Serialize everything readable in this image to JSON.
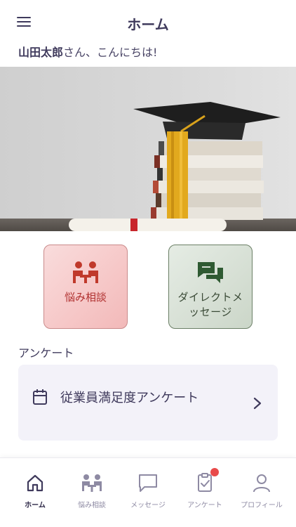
{
  "header": {
    "title": "ホーム",
    "menu_icon": "hamburger-menu-icon"
  },
  "greeting": {
    "name": "山田太郎",
    "suffix": "さん、こんにちは!"
  },
  "hero": {
    "image": "graduation-cap-on-books-photo"
  },
  "actions": [
    {
      "label": "悩み相談",
      "icon": "consultation-icon",
      "color": "#b0302f"
    },
    {
      "label_line1": "ダイレクトメ",
      "label_line2": "ッセージ",
      "icon": "chat-bubbles-icon",
      "color": "#3a4a36"
    }
  ],
  "survey_section": {
    "label": "アンケート",
    "card": {
      "text": "従業員満足度アンケート",
      "icon": "calendar-icon",
      "chevron_icon": "chevron-right-icon"
    }
  },
  "tabbar": {
    "tabs": [
      {
        "label": "ホーム",
        "icon": "home-icon",
        "active": true
      },
      {
        "label": "悩み相談",
        "icon": "consultation-icon",
        "active": false
      },
      {
        "label": "メッセージ",
        "icon": "message-icon",
        "active": false
      },
      {
        "label": "アンケート",
        "icon": "clipboard-check-icon",
        "active": false,
        "badge": true
      },
      {
        "label": "プロフィール",
        "icon": "profile-icon",
        "active": false
      }
    ]
  },
  "colors": {
    "accent": "#3f3a5c",
    "badge": "#e84a4a"
  }
}
